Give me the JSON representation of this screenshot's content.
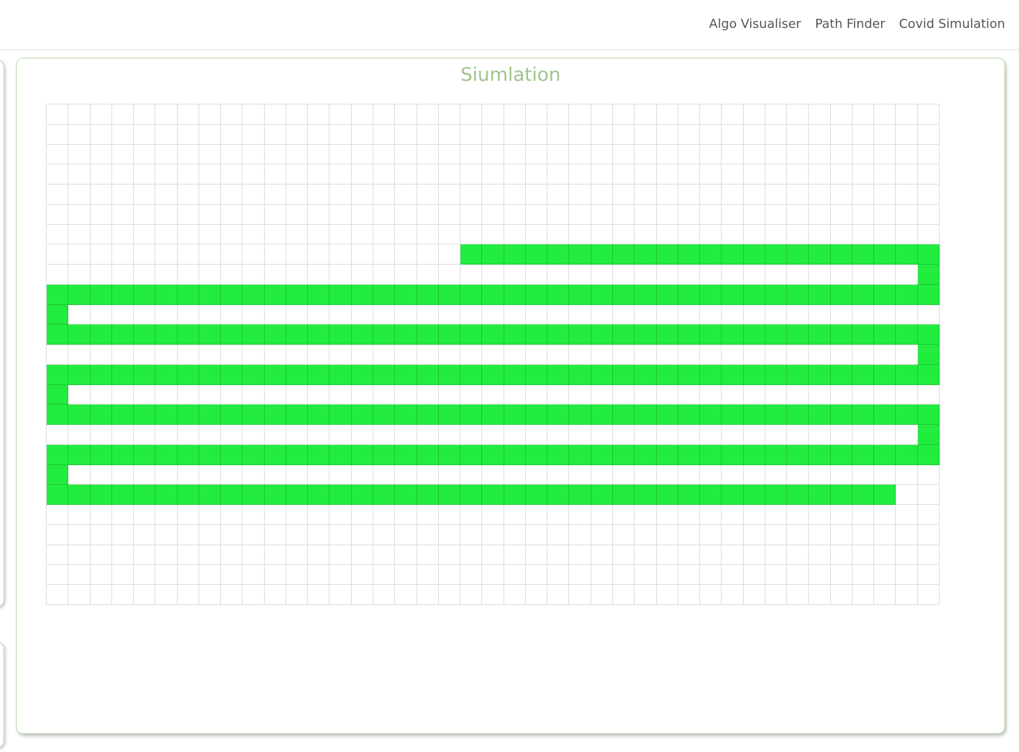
{
  "navbar": {
    "links": [
      {
        "label": "Algo Visualiser"
      },
      {
        "label": "Path Finder"
      },
      {
        "label": "Covid Simulation"
      }
    ]
  },
  "simulation": {
    "title": "Siumlation",
    "active_color": "#22ec40",
    "grid": {
      "rows": 25,
      "cols": 41,
      "active_segments": [
        {
          "row": 7,
          "from": 19,
          "to": 40
        },
        {
          "row": 8,
          "from": 40,
          "to": 40
        },
        {
          "row": 9,
          "from": 0,
          "to": 40
        },
        {
          "row": 10,
          "from": 0,
          "to": 0
        },
        {
          "row": 11,
          "from": 0,
          "to": 40
        },
        {
          "row": 12,
          "from": 40,
          "to": 40
        },
        {
          "row": 13,
          "from": 0,
          "to": 40
        },
        {
          "row": 14,
          "from": 0,
          "to": 0
        },
        {
          "row": 15,
          "from": 0,
          "to": 40
        },
        {
          "row": 16,
          "from": 40,
          "to": 40
        },
        {
          "row": 17,
          "from": 0,
          "to": 40
        },
        {
          "row": 18,
          "from": 0,
          "to": 0
        },
        {
          "row": 19,
          "from": 0,
          "to": 38
        }
      ]
    }
  }
}
